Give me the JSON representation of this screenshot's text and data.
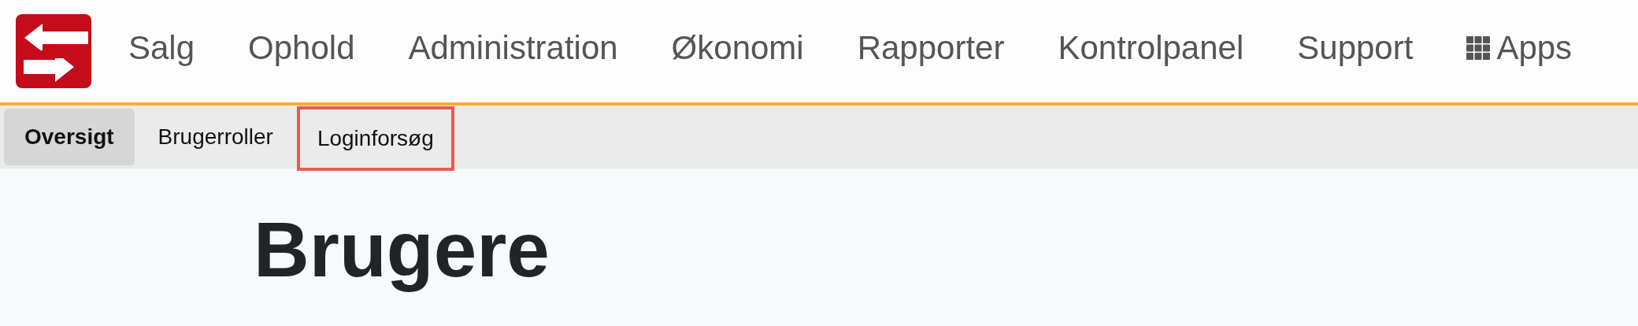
{
  "top_nav": {
    "items": [
      {
        "label": "Salg",
        "kind": "link"
      },
      {
        "label": "Ophold",
        "kind": "link"
      },
      {
        "label": "Administration",
        "kind": "link"
      },
      {
        "label": "Økonomi",
        "kind": "link"
      },
      {
        "label": "Rapporter",
        "kind": "link"
      },
      {
        "label": "Kontrolpanel",
        "kind": "link"
      },
      {
        "label": "Support",
        "kind": "link"
      },
      {
        "label": "Apps",
        "kind": "apps"
      }
    ]
  },
  "sub_nav": {
    "tabs": [
      {
        "label": "Oversigt",
        "selected": true,
        "highlighted": false
      },
      {
        "label": "Brugerroller",
        "selected": false,
        "highlighted": false
      },
      {
        "label": "Loginforsøg",
        "selected": false,
        "highlighted": true
      }
    ]
  },
  "page": {
    "heading": "Brugere"
  }
}
